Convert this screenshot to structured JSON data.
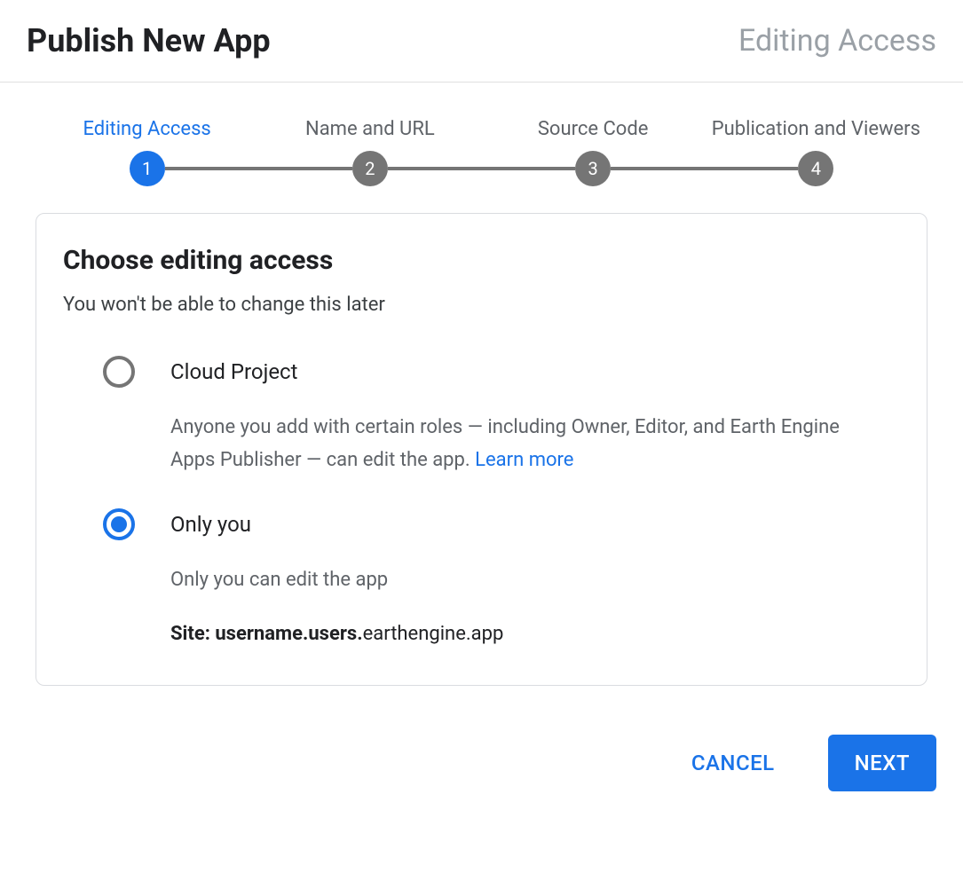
{
  "header": {
    "title": "Publish New App",
    "current_step_name": "Editing Access"
  },
  "stepper": {
    "steps": [
      {
        "label": "Editing Access",
        "number": "1"
      },
      {
        "label": "Name and URL",
        "number": "2"
      },
      {
        "label": "Source Code",
        "number": "3"
      },
      {
        "label": "Publication and Viewers",
        "number": "4"
      }
    ]
  },
  "card": {
    "title": "Choose editing access",
    "subtitle": "You won't be able to change this later"
  },
  "options": {
    "cloud": {
      "title": "Cloud Project",
      "desc_prefix": "Anyone you add with certain roles — including Owner, Editor, and Earth Engine Apps Publisher — can edit the app. ",
      "learn_more": "Learn more"
    },
    "only_you": {
      "title": "Only you",
      "desc": "Only you can edit the app",
      "site_label": "Site: ",
      "site_bold": "username.users.",
      "site_rest": "earthengine.app"
    }
  },
  "footer": {
    "cancel": "CANCEL",
    "next": "NEXT"
  }
}
